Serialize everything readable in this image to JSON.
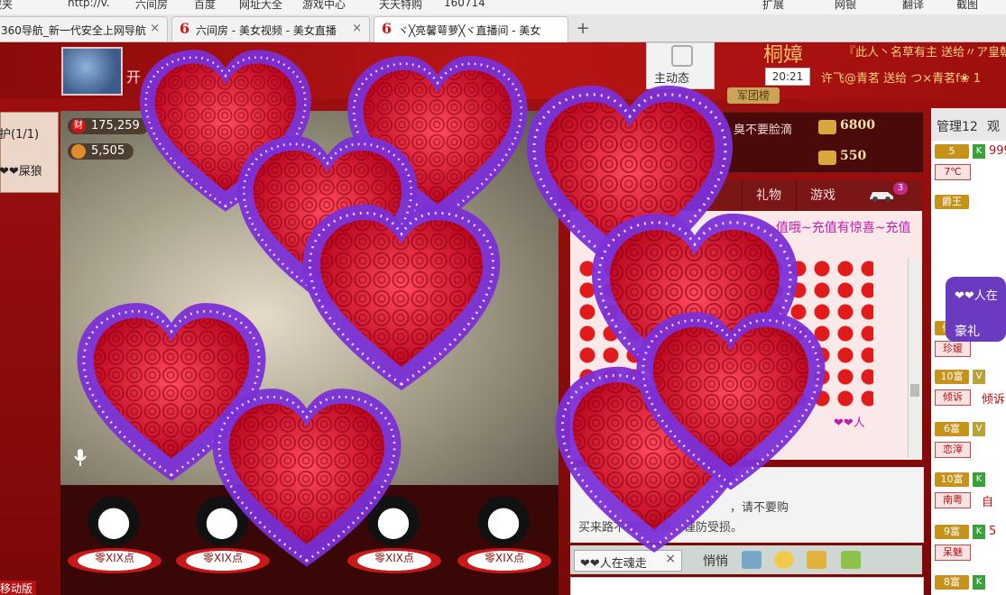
{
  "bookmarks": [
    {
      "label": "收藏夹"
    },
    {
      "label": "http://v."
    },
    {
      "label": "六间房"
    },
    {
      "label": "百度"
    },
    {
      "label": "网址大全"
    },
    {
      "label": "游戏中心"
    },
    {
      "label": "天天特购"
    },
    {
      "label": "160714"
    },
    {
      "label": "扩展"
    },
    {
      "label": "网银"
    },
    {
      "label": "翻译"
    },
    {
      "label": "截图"
    }
  ],
  "tabs": [
    {
      "title": "360导航_新一代安全上网导航",
      "close": "×"
    },
    {
      "title": "六间房 - 美女视频 - 美女直播",
      "close": "×"
    },
    {
      "title": "ヾ╳亮馨萼萝╳ヾ直播间 - 美女",
      "close": "×"
    }
  ],
  "new_tab": "+",
  "header": {
    "open_text": "开",
    "host_dynamics": "主动态",
    "host_name": "桐嫜",
    "ticker1": "『此人丶名草有主 送给〃ア皇朝",
    "time": "20:21",
    "ticker2": "许飞@青茗 送给 つ×青茗f❀ 1",
    "army_btn": "军团榜"
  },
  "guard": {
    "title": "护(1/1)",
    "name": "❤❤屎狼"
  },
  "left_bottom": "移动版",
  "video": {
    "wealth_icon": "财",
    "wealth": "175,259",
    "fans": "5,505"
  },
  "seats": [
    {
      "label": "零XIX点"
    },
    {
      "label": "零XIX点"
    },
    {
      "label": "零XIX点"
    },
    {
      "label": "零XIX点"
    }
  ],
  "rich": [
    {
      "name": "臭不要脸滴",
      "value": "6800"
    },
    {
      "name": "",
      "value": "550"
    }
  ],
  "chat_tabs": [
    {
      "label": "礼物"
    },
    {
      "label": "游戏"
    }
  ],
  "car_count": "3",
  "chat": {
    "notice": "值哦~充值有惊喜~充值",
    "tail": "❤❤人"
  },
  "system": {
    "line1": "，请不要购",
    "line2": "买来路不明的道具，谨防受损。"
  },
  "input_bar": {
    "target": "❤❤人在魂走",
    "close": "×",
    "whisper": "悄悄"
  },
  "user_panel": {
    "tab_admin": "管理12",
    "tab_audience": "观",
    "users": [
      {
        "level": "5",
        "name": "999"
      },
      {
        "level": "爵王",
        "name": ""
      },
      {
        "level": "伯爵",
        "name": ""
      },
      {
        "level": "10富",
        "name": "倾诉"
      },
      {
        "level": "6富",
        "name": ""
      },
      {
        "level": "10富",
        "name": "自"
      },
      {
        "level": "9富",
        "name": "5"
      },
      {
        "level": "8富",
        "name": ""
      }
    ],
    "sub_tags": [
      "7℃",
      "珍媛",
      "倾诉",
      "恋滓",
      "南粤",
      "呆魅"
    ]
  },
  "float_gift": {
    "t1": "❤❤人在",
    "t2": "豪礼"
  },
  "colors": {
    "brand_red": "#a0100f",
    "heart_red": "#e11a1a",
    "heart_wrap": "#8a3be0"
  }
}
